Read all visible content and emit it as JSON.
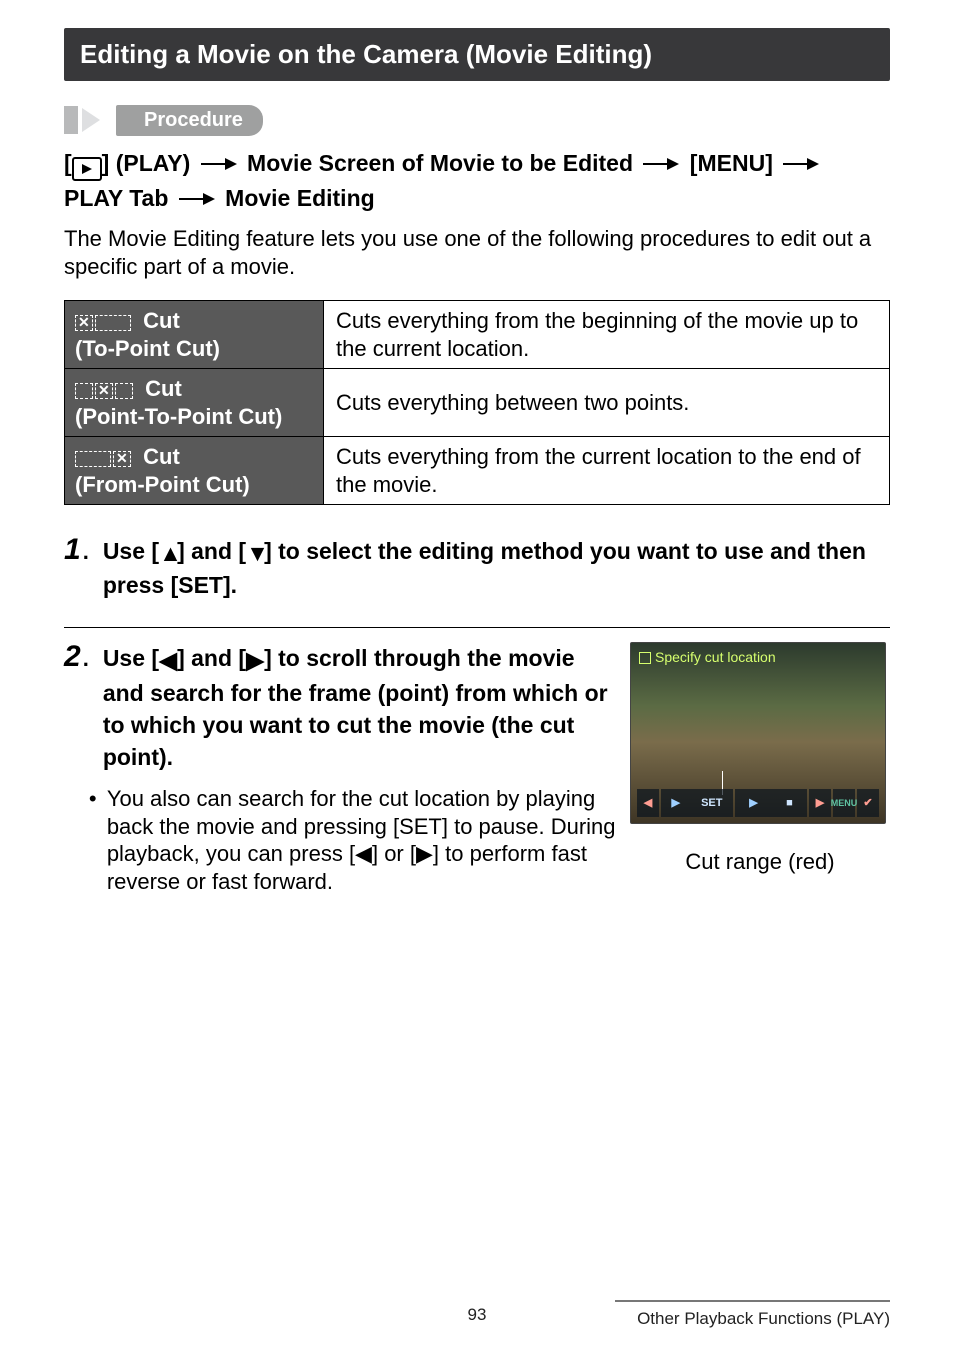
{
  "header": {
    "title": "Editing a Movie on the Camera (Movie Editing)"
  },
  "procedure": {
    "label": "Procedure",
    "path_before_icon": "[",
    "play_word": "] (PLAY) ",
    "seg1": " Movie Screen of Movie to be Edited ",
    "seg2": " [MENU] ",
    "seg3_top": "",
    "path_line2": "PLAY Tab ",
    "seg4": " Movie Editing"
  },
  "intro": "The Movie Editing feature lets you use one of the following procedures to edit out a specific part of a movie.",
  "table": {
    "row1": {
      "title": " Cut",
      "sub": "(To-Point Cut)",
      "desc": "Cuts everything from the beginning of the movie up to the current location."
    },
    "row2": {
      "title": " Cut",
      "sub": "(Point-To-Point Cut)",
      "desc": "Cuts everything between two points."
    },
    "row3": {
      "title": " Cut",
      "sub": "(From-Point Cut)",
      "desc": "Cuts everything from the current location to the end of the movie."
    }
  },
  "steps": {
    "s1": {
      "num": "1",
      "text_a": "Use [",
      "text_b": "] and [",
      "text_c": "] to select the editing method you want to use and then press [SET]."
    },
    "s2": {
      "num": "2",
      "text_a": "Use [",
      "text_b": "] and [",
      "text_c": "] to scroll through the movie and search for the frame (point) from which or to which you want to cut the movie (the cut point).",
      "bullet": "You also can search for the cut location by playing back the movie and pressing [SET] to pause. During playback, you can press [◀] or [▶] to perform fast reverse or fast forward."
    }
  },
  "preview": {
    "top_label": "Specify cut location",
    "btn_left": "◀",
    "btn_set": "SET",
    "btn_play": "▶",
    "btn_right": "▶",
    "btn_stop": "■",
    "btn_menu": "MENU",
    "btn_check": "✔",
    "caption": "Cut range (red)"
  },
  "footer": {
    "page": "93",
    "section": "Other Playback Functions (PLAY)"
  }
}
